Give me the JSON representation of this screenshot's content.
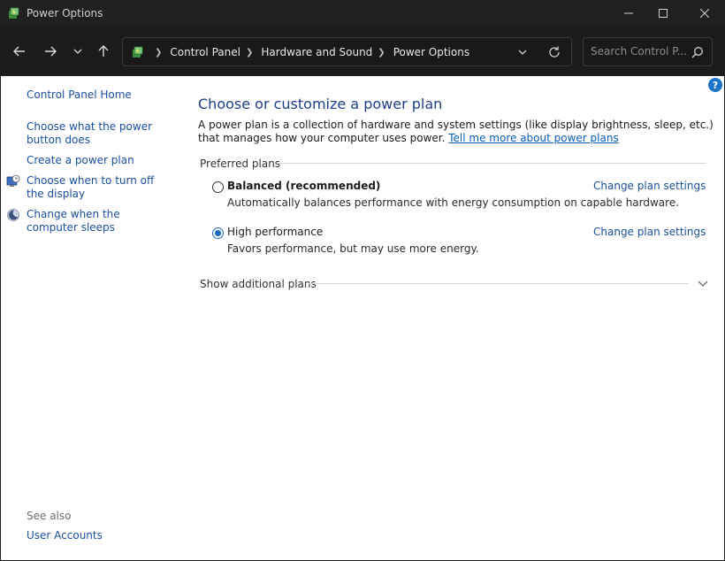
{
  "window": {
    "title": "Power Options",
    "app_icon": "power-options-icon"
  },
  "address": {
    "crumbs": [
      "Control Panel",
      "Hardware and Sound",
      "Power Options"
    ]
  },
  "search": {
    "placeholder": "Search Control P..."
  },
  "sidebar": {
    "home": "Control Panel Home",
    "items": [
      {
        "label": "Choose what the power button does",
        "icon": null
      },
      {
        "label": "Create a power plan",
        "icon": null
      },
      {
        "label": "Choose when to turn off the display",
        "icon": "display-clock-icon"
      },
      {
        "label": "Change when the computer sleeps",
        "icon": "moon-icon"
      }
    ],
    "see_also": "See also",
    "see_also_items": [
      "User Accounts"
    ]
  },
  "main": {
    "title": "Choose or customize a power plan",
    "description": "A power plan is a collection of hardware and system settings (like display brightness, sleep, etc.) that manages how your computer uses power.",
    "learn_more_link": "Tell me more about power plans",
    "preferred_plans_label": "Preferred plans",
    "plans": [
      {
        "name": "Balanced (recommended)",
        "description": "Automatically balances performance with energy consumption on capable hardware.",
        "link": "Change plan settings",
        "selected": false
      },
      {
        "name": "High performance",
        "description": "Favors performance, but may use more energy.",
        "link": "Change plan settings",
        "selected": true
      }
    ],
    "show_additional": "Show additional plans"
  },
  "colors": {
    "link": "#1a4f9c",
    "title": "#1e3f8a",
    "accent": "#1a66c4"
  }
}
